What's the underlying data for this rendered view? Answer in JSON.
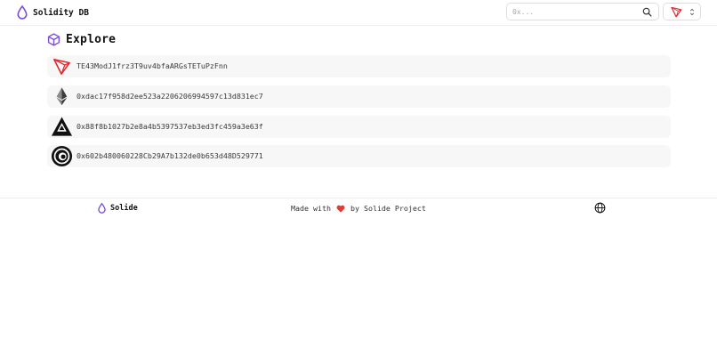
{
  "header": {
    "app_title": "Solidity DB",
    "search": {
      "placeholder": "0x...",
      "value": ""
    }
  },
  "explore": {
    "heading": "Explore",
    "items": [
      {
        "network": "tron",
        "address": "TE43ModJ1frz3T9uv4bfaARGsTETuPzFnn"
      },
      {
        "network": "ethereum",
        "address": "0xdac17f958d2ee523a2206206994597c13d831ec7"
      },
      {
        "network": "avalanche-like",
        "address": "0x88f8b1027b2e8a4b5397537eb3ed3fc459a3e63f"
      },
      {
        "network": "circle-chain",
        "address": "0x602b480060228Cb29A7b132de0b653d48D529771"
      }
    ]
  },
  "footer": {
    "brand": "Solide",
    "credit_before": "Made with",
    "credit_after": "by Solide Project"
  },
  "colors": {
    "brand_purple": "#7b4fd6",
    "tron_red": "#e3262d",
    "heart_red": "#e53935"
  }
}
